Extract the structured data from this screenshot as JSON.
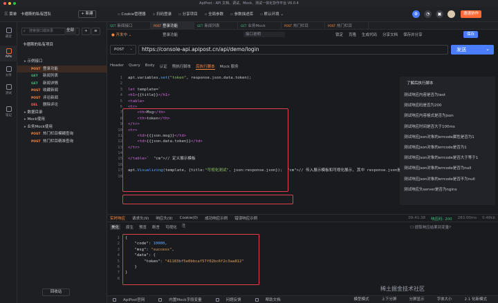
{
  "window": {
    "title": "ApiPost - API 文档、调试、Mock、测试一体化协作平台 V6.0.4"
  },
  "topbar": {
    "menu_label": "三 菜单",
    "team_label": "卡德斯的私有团队",
    "new_label": "+ 新建",
    "links": [
      "Cookie管理器",
      "扫码登录",
      "分享项目",
      "全局参数",
      "参数描述库",
      "默认环境 ⌄"
    ],
    "invite_label": "邀请协作",
    "colors": {
      "accent": "#ff6a33",
      "blue": "#4a7dff"
    }
  },
  "leftnav": {
    "items": [
      {
        "label": "最近"
      },
      {
        "label": "APIs"
      },
      {
        "label": "分享"
      },
      {
        "label": "测试"
      },
      {
        "label": "笔记"
      }
    ]
  },
  "sidebar": {
    "search_placeholder": "搜索接口或目录",
    "filter_label": "全部",
    "project_name": "卡德斯的私有项目",
    "tree": [
      {
        "type": "folder",
        "label": "示例接口",
        "indent": 0
      },
      {
        "type": "api",
        "method": "POST",
        "label": "登录功能",
        "indent": 1,
        "selected": true
      },
      {
        "type": "api",
        "method": "GET",
        "label": "新闻列表",
        "indent": 1
      },
      {
        "type": "api",
        "method": "GET",
        "label": "新闻详情",
        "indent": 1
      },
      {
        "type": "api",
        "method": "POST",
        "label": "收藏新闻",
        "indent": 1
      },
      {
        "type": "api",
        "method": "POST",
        "label": "评论新闻",
        "indent": 1
      },
      {
        "type": "api",
        "method": "DEL",
        "label": "删除评论",
        "indent": 1
      },
      {
        "type": "folder",
        "label": "数据目录",
        "indent": 0
      },
      {
        "type": "folder",
        "label": "Mock使用",
        "indent": 0
      },
      {
        "type": "folder",
        "label": "业务Mock使用",
        "indent": 0
      },
      {
        "type": "api",
        "method": "POST",
        "label": "热门栏目模糊查询",
        "indent": 1
      },
      {
        "type": "api",
        "method": "POST",
        "label": "热门栏目精准查询",
        "indent": 1
      }
    ],
    "recycle_label": "回收站"
  },
  "tabs": [
    {
      "method": "GET",
      "label": "新闻接口",
      "active": false
    },
    {
      "method": "POST",
      "label": "登录功能",
      "active": true
    },
    {
      "method": "GET",
      "label": "新闻列表",
      "active": false
    },
    {
      "method": "GET",
      "label": "业务Mock",
      "active": false
    },
    {
      "method": "POST",
      "label": "热门栏目",
      "active": false
    },
    {
      "method": "POST",
      "label": "热门栏目",
      "active": false
    }
  ],
  "request": {
    "name": "登录功能",
    "desc_placeholder": "接口说明",
    "actions": [
      "锁定",
      "克隆",
      "生成代码",
      "分享文档",
      "保存并分享"
    ],
    "save_label": "保存",
    "method": "POST",
    "url": "https://console-api.apipost.cn/api/demo/login",
    "send_label": "发送",
    "subtabs": [
      "Header",
      "Query",
      "Body",
      "认证",
      "预执行脚本",
      "后执行脚本",
      "Mock 服务"
    ],
    "active_subtab": "后执行脚本"
  },
  "editor": {
    "line_numbers": [
      "1",
      "2",
      "3",
      "4",
      "5",
      "6",
      "7",
      "8",
      "9",
      "10",
      "11",
      "12",
      "13",
      "14",
      "15",
      "16",
      "17",
      "18"
    ],
    "lines": [
      "apt.variables.set(\"token\", response.json.data.token);",
      "",
      "let template=`",
      "<h1>{{title}}</h1>",
      "<table>",
      "<tr>",
      "    <th>Msg</th>",
      "    <th>token</th>",
      "</tr>",
      "<tr>",
      "    <td>{{json.msg}}</td>",
      "    <td>{{json.data.token}}</td>",
      "</tr>",
      "",
      "</table>`  // 定义展示模板",
      "",
      "apt.Visualizing(template, {title:\"可视化测试\", json:response.json});  // 传入展示模板和可视化展示, 其中 response.json是",
      ""
    ]
  },
  "snippets": {
    "title": "了解后执行脚本",
    "items": [
      "测试响应内容是否为test",
      "测试响应码是否为200",
      "测试响应内容格式是否为json",
      "测试响应时间是否大于100ms",
      "测试响应Json对象的errcode属性是否为1",
      "测试响应Json对象的errcode是否为1",
      "测试响应Json对象的errcode是否大于等于1",
      "测试响应Json对象的errcode是否为null",
      "测试响应Json对象的errcode是否不为null",
      "测试响应头server是否为nginx"
    ]
  },
  "response": {
    "tabs": [
      "实时响应",
      "请求头(9)",
      "响应头(9)",
      "Cookie(0)",
      "成功响应示例",
      "错误响应示例"
    ],
    "meta": [
      "09:41:38",
      "响应码: 200",
      "283.00ms",
      "0.48kb"
    ],
    "view_tabs": [
      "美化",
      "原生",
      "预览",
      "断言",
      "可视化",
      "⎘"
    ],
    "checkbox_label": "☐ 提取响应结果到变量?",
    "line_numbers": [
      "1",
      "2",
      "3",
      "4",
      "5",
      "6",
      "7",
      "8"
    ],
    "json_lines": [
      "{",
      "    \"code\": 10000,",
      "    \"msg\": \"success\",",
      "    \"data\": {",
      "        \"token\": \"41183bf5e0bbcaf57f02bc6f2c3aa812\"",
      "    }",
      "}",
      ""
    ]
  },
  "statusbar": {
    "left": [
      "ApiPost官网",
      "内置Mock字段变量",
      "问题反馈",
      "帮助文档"
    ],
    "right": [
      "模型模式",
      "上下分屏",
      "分屏显示",
      "字体大小",
      "2.1 化新模式"
    ]
  },
  "watermark": "稀土掘金技术社区"
}
